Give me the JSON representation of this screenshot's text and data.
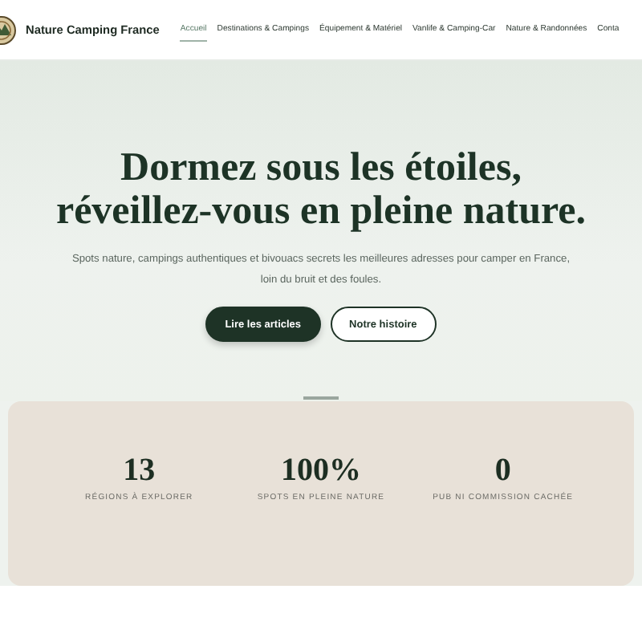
{
  "header": {
    "brand": "Nature Camping France",
    "nav": [
      {
        "label": "Accueil",
        "selected": true
      },
      {
        "label": "Destinations & Campings",
        "selected": false
      },
      {
        "label": "Équipement & Matériel",
        "selected": false
      },
      {
        "label": "Vanlife & Camping-Car",
        "selected": false
      },
      {
        "label": "Nature & Randonnées",
        "selected": false
      },
      {
        "label": "Conta",
        "selected": false
      }
    ]
  },
  "hero": {
    "title_lines": [
      "Dormez sous les étoiles,",
      "réveillez-vous en pleine nature."
    ],
    "subtitle": "Spots nature, campings authentiques et bivouacs secrets les meilleures adresses pour camper en France, loin du bruit et des foules.",
    "buttons": [
      {
        "label": "Lire les articles",
        "kind": "primary"
      },
      {
        "label": "Notre histoire",
        "kind": "outline"
      }
    ]
  },
  "stats": [
    {
      "value": "13",
      "label": "RÉGIONS À EXPLORER"
    },
    {
      "value": "100%",
      "label": "SPOTS EN PLEINE NATURE"
    },
    {
      "value": "0",
      "label": "PUB NI COMMISSION CACHÉE"
    }
  ]
}
